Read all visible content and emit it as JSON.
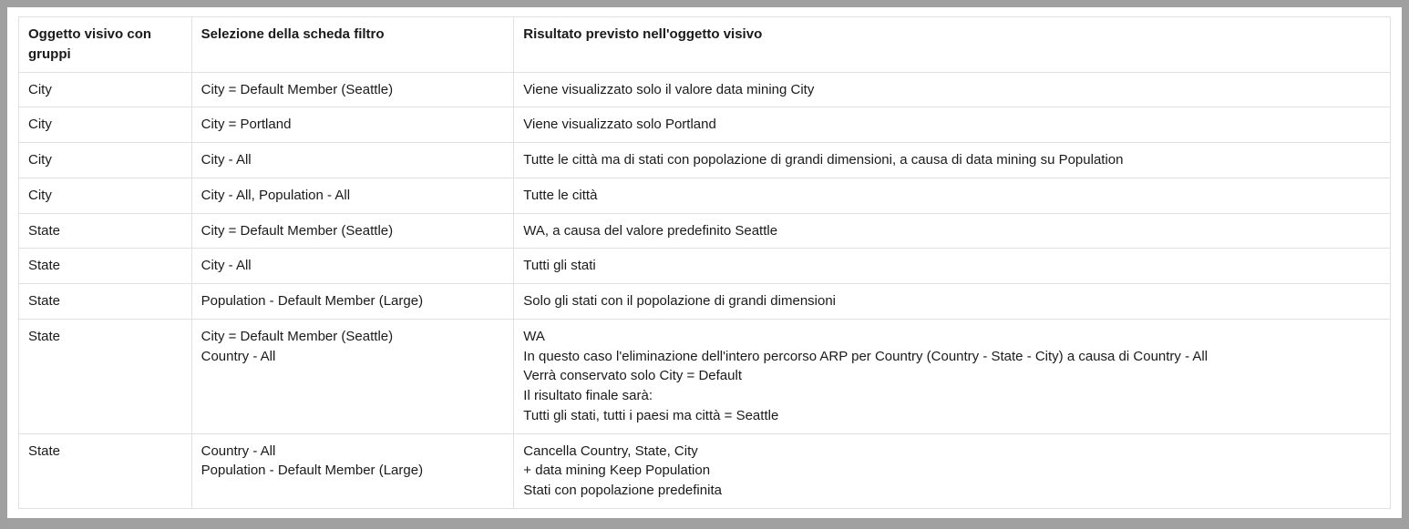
{
  "headers": {
    "c1": "Oggetto visivo con gruppi",
    "c2": "Selezione della scheda filtro",
    "c3": "Risultato previsto nell'oggetto visivo"
  },
  "rows": [
    {
      "c1": [
        "City"
      ],
      "c2": [
        "City = Default Member (Seattle)"
      ],
      "c3": [
        "Viene visualizzato solo il valore data mining City"
      ]
    },
    {
      "c1": [
        "City"
      ],
      "c2": [
        "City = Portland"
      ],
      "c3": [
        "Viene visualizzato solo Portland"
      ]
    },
    {
      "c1": [
        "City"
      ],
      "c2": [
        "City - All"
      ],
      "c3": [
        "Tutte le città ma di stati con popolazione di grandi dimensioni, a causa di data mining su Population"
      ]
    },
    {
      "c1": [
        "City"
      ],
      "c2": [
        "City - All, Population - All"
      ],
      "c3": [
        "Tutte le città"
      ]
    },
    {
      "c1": [
        "State"
      ],
      "c2": [
        "City = Default Member (Seattle)"
      ],
      "c3": [
        "WA, a causa del valore predefinito Seattle"
      ]
    },
    {
      "c1": [
        "State"
      ],
      "c2": [
        "City - All"
      ],
      "c3": [
        "Tutti gli stati"
      ]
    },
    {
      "c1": [
        "State"
      ],
      "c2": [
        "Population - Default Member (Large)"
      ],
      "c3": [
        "Solo gli stati con il popolazione di grandi dimensioni"
      ]
    },
    {
      "c1": [
        "State"
      ],
      "c2": [
        "City = Default Member (Seattle)",
        "Country - All"
      ],
      "c3": [
        "WA",
        "In questo caso l'eliminazione dell'intero percorso ARP per Country (Country - State - City) a causa di Country - All",
        "Verrà conservato solo City = Default",
        "Il risultato finale sarà:",
        "Tutti gli stati, tutti i paesi ma città = Seattle"
      ]
    },
    {
      "c1": [
        "State"
      ],
      "c2": [
        "Country - All",
        "Population - Default Member (Large)"
      ],
      "c3": [
        "Cancella Country, State, City",
        "+ data mining Keep Population",
        "Stati con popolazione predefinita"
      ]
    }
  ]
}
